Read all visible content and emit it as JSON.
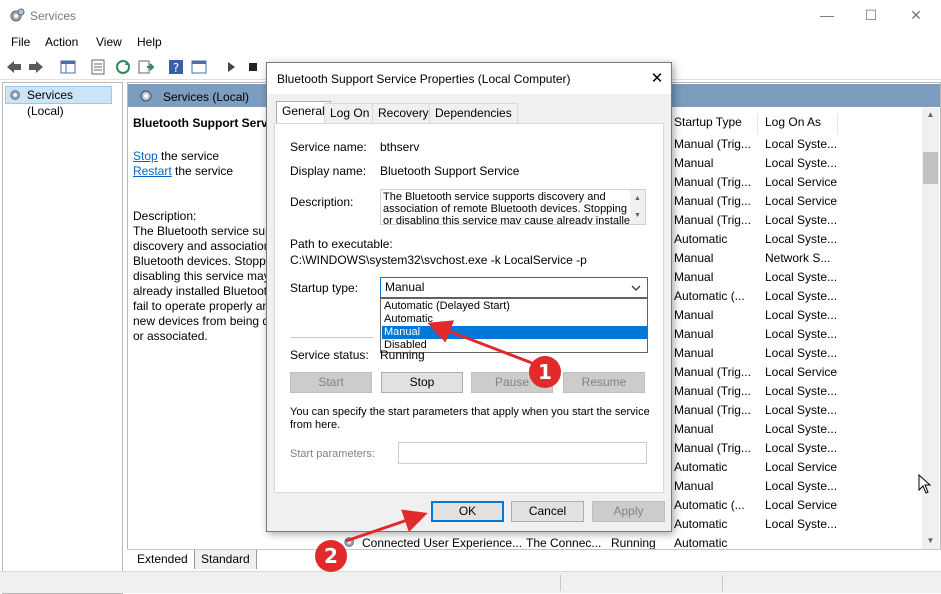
{
  "window": {
    "title": "Services"
  },
  "menu": [
    "File",
    "Action",
    "View",
    "Help"
  ],
  "tree": {
    "item": "Services (Local)"
  },
  "right_header": "Services (Local)",
  "desc_panel": {
    "title": "Bluetooth Support Servi",
    "stop_link": "Stop",
    "stop_rest": " the service",
    "restart_link": "Restart",
    "restart_rest": " the service",
    "description_label": "Description:",
    "lines": [
      "The Bluetooth service sup",
      "discovery and association",
      "Bluetooth devices.  Stopp",
      "disabling this service may",
      "already installed Bluetoot",
      "fail to operate properly an",
      "new devices from being d",
      "or associated."
    ]
  },
  "columns": {
    "startup_type": "Startup Type",
    "log_on_as": "Log On As"
  },
  "rows": [
    {
      "startup": "Manual (Trig...",
      "logon": "Local Syste..."
    },
    {
      "startup": "Manual",
      "logon": "Local Syste..."
    },
    {
      "startup": "Manual (Trig...",
      "logon": "Local Service"
    },
    {
      "startup": "Manual (Trig...",
      "logon": "Local Service"
    },
    {
      "startup": "Manual (Trig...",
      "logon": "Local Syste..."
    },
    {
      "startup": "Automatic",
      "logon": "Local Syste..."
    },
    {
      "startup": "Manual",
      "logon": "Network S..."
    },
    {
      "startup": "Manual",
      "logon": "Local Syste..."
    },
    {
      "startup": "Automatic (...",
      "logon": "Local Syste..."
    },
    {
      "startup": "Manual",
      "logon": "Local Syste..."
    },
    {
      "startup": "Manual",
      "logon": "Local Syste..."
    },
    {
      "startup": "Manual",
      "logon": "Local Syste..."
    },
    {
      "startup": "Manual (Trig...",
      "logon": "Local Service"
    },
    {
      "startup": "Manual (Trig...",
      "logon": "Local Syste..."
    },
    {
      "startup": "Manual (Trig...",
      "logon": "Local Syste..."
    },
    {
      "startup": "Manual",
      "logon": "Local Syste..."
    },
    {
      "startup": "Manual (Trig...",
      "logon": "Local Syste..."
    },
    {
      "startup": "Automatic",
      "logon": "Local Service"
    },
    {
      "startup": "Manual",
      "logon": "Local Syste..."
    },
    {
      "startup": "Automatic (...",
      "logon": "Local Service"
    },
    {
      "startup": "Automatic",
      "logon": "Local Syste..."
    }
  ],
  "last_row": {
    "name": "Connected User Experience...",
    "desc": "The Connec...",
    "status": "Running",
    "startup": "Automatic"
  },
  "bottom_tabs": [
    "Extended",
    "Standard"
  ],
  "dialog": {
    "title": "Bluetooth Support Service Properties (Local Computer)",
    "close": "✕",
    "tabs": [
      "General",
      "Log On",
      "Recovery",
      "Dependencies"
    ],
    "service_name_label": "Service name:",
    "service_name": "bthserv",
    "display_name_label": "Display name:",
    "display_name": "Bluetooth Support Service",
    "description_label": "Description:",
    "description_lines": [
      "The Bluetooth service supports discovery and",
      "association of remote Bluetooth devices.  Stopping",
      "or disabling this service may cause already installed"
    ],
    "path_label": "Path to executable:",
    "path": "C:\\WINDOWS\\system32\\svchost.exe -k LocalService -p",
    "startup_type_label": "Startup type:",
    "startup_type_value": "Manual",
    "startup_options": [
      "Automatic (Delayed Start)",
      "Automatic",
      "Manual",
      "Disabled"
    ],
    "service_status_label": "Service status:",
    "service_status": "Running",
    "buttons": {
      "start": "Start",
      "stop": "Stop",
      "pause": "Pause",
      "resume": "Resume"
    },
    "hint_line1": "You can specify the start parameters that apply when you start the service",
    "hint_line2": "from here.",
    "start_params_label": "Start parameters:",
    "ok": "OK",
    "cancel": "Cancel",
    "apply": "Apply"
  },
  "annotations": {
    "badge1": "1",
    "badge2": "2"
  },
  "colors": {
    "accent": "#0078d7",
    "header_blue": "#7c9dc0",
    "annotation_red": "#e12b2b"
  }
}
